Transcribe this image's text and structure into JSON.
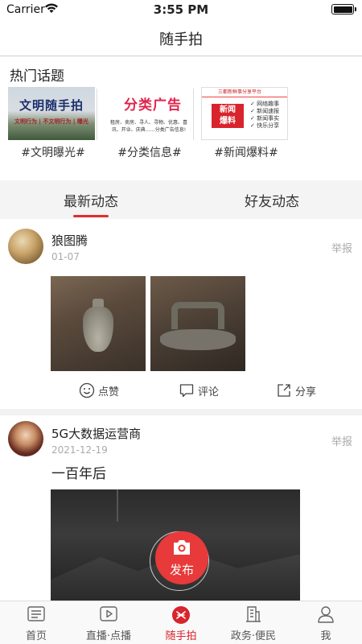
{
  "status_bar": {
    "carrier": "Carrier",
    "time": "3:55 PM"
  },
  "nav": {
    "title": "随手拍"
  },
  "hot_topics": {
    "title": "热门话题",
    "items": [
      {
        "label": "#文明曝光#",
        "image_title": "文明随手拍",
        "image_subtitle": "文明行为 | 不文明行为 | 曝光"
      },
      {
        "label": "#分类信息#",
        "image_title": "分类广告",
        "image_subtitle": "租房、卖房、寻人、寻物、优惠、喜讯、开业、庆典……分类广告信息!"
      },
      {
        "label": "#新闻爆料#",
        "image_title": "新闻\n爆料",
        "image_header": "三都新鲜事分享平台",
        "image_list": [
          "✓ 网络趣事",
          "✓ 新闻速报",
          "✓ 新闻事实",
          "✓ 快乐分享"
        ]
      }
    ]
  },
  "tabs": {
    "latest": "最新动态",
    "friends": "好友动态",
    "active": "latest"
  },
  "posts": [
    {
      "username": "狼图腾",
      "date": "01-07",
      "report": "举报",
      "actions": {
        "like": "点赞",
        "comment": "评论",
        "share": "分享"
      }
    },
    {
      "username": "5G大数据运营商",
      "date": "2021-12-19",
      "report": "举报",
      "text": "一百年后"
    }
  ],
  "publish": {
    "label": "发布"
  },
  "tabbar": {
    "active": "suishoupai",
    "items": [
      {
        "id": "home",
        "label": "首页",
        "icon": "news-icon"
      },
      {
        "id": "live",
        "label": "直播·点播",
        "icon": "play-icon"
      },
      {
        "id": "suishoupai",
        "label": "随手拍",
        "icon": "snapshot-icon"
      },
      {
        "id": "gov",
        "label": "政务·便民",
        "icon": "building-icon"
      },
      {
        "id": "me",
        "label": "我",
        "icon": "user-icon"
      }
    ]
  },
  "colors": {
    "accent": "#d8242c",
    "publish": "#e83a3a"
  }
}
